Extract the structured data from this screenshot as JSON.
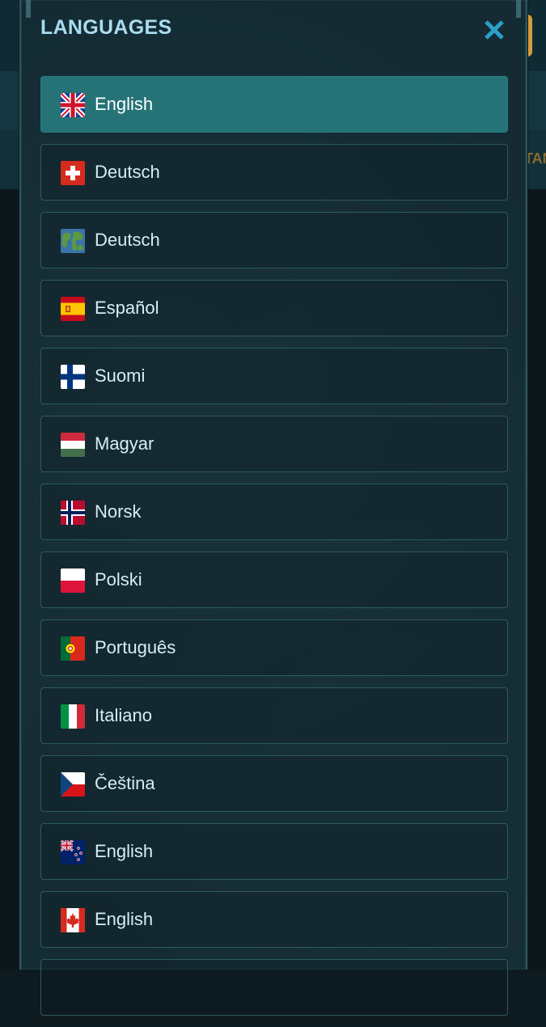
{
  "modal": {
    "title": "LANGUAGES",
    "close_icon": "close-icon"
  },
  "background": {
    "partial_text": "TAN"
  },
  "languages": [
    {
      "label": "English",
      "flag": "uk-flag-icon",
      "selected": true
    },
    {
      "label": "Deutsch",
      "flag": "swiss-flag-icon",
      "selected": false
    },
    {
      "label": "Deutsch",
      "flag": "globe-flag-icon",
      "selected": false
    },
    {
      "label": "Español",
      "flag": "spain-flag-icon",
      "selected": false
    },
    {
      "label": "Suomi",
      "flag": "finland-flag-icon",
      "selected": false
    },
    {
      "label": "Magyar",
      "flag": "hungary-flag-icon",
      "selected": false
    },
    {
      "label": "Norsk",
      "flag": "norway-flag-icon",
      "selected": false
    },
    {
      "label": "Polski",
      "flag": "poland-flag-icon",
      "selected": false
    },
    {
      "label": "Português",
      "flag": "portugal-flag-icon",
      "selected": false
    },
    {
      "label": "Italiano",
      "flag": "italy-flag-icon",
      "selected": false
    },
    {
      "label": "Čeština",
      "flag": "czech-flag-icon",
      "selected": false
    },
    {
      "label": "English",
      "flag": "new-zealand-flag-icon",
      "selected": false
    },
    {
      "label": "English",
      "flag": "canada-flag-icon",
      "selected": false
    }
  ],
  "colors": {
    "accent": "#257377",
    "title": "#a9dcef",
    "close": "#2aa0c8"
  }
}
